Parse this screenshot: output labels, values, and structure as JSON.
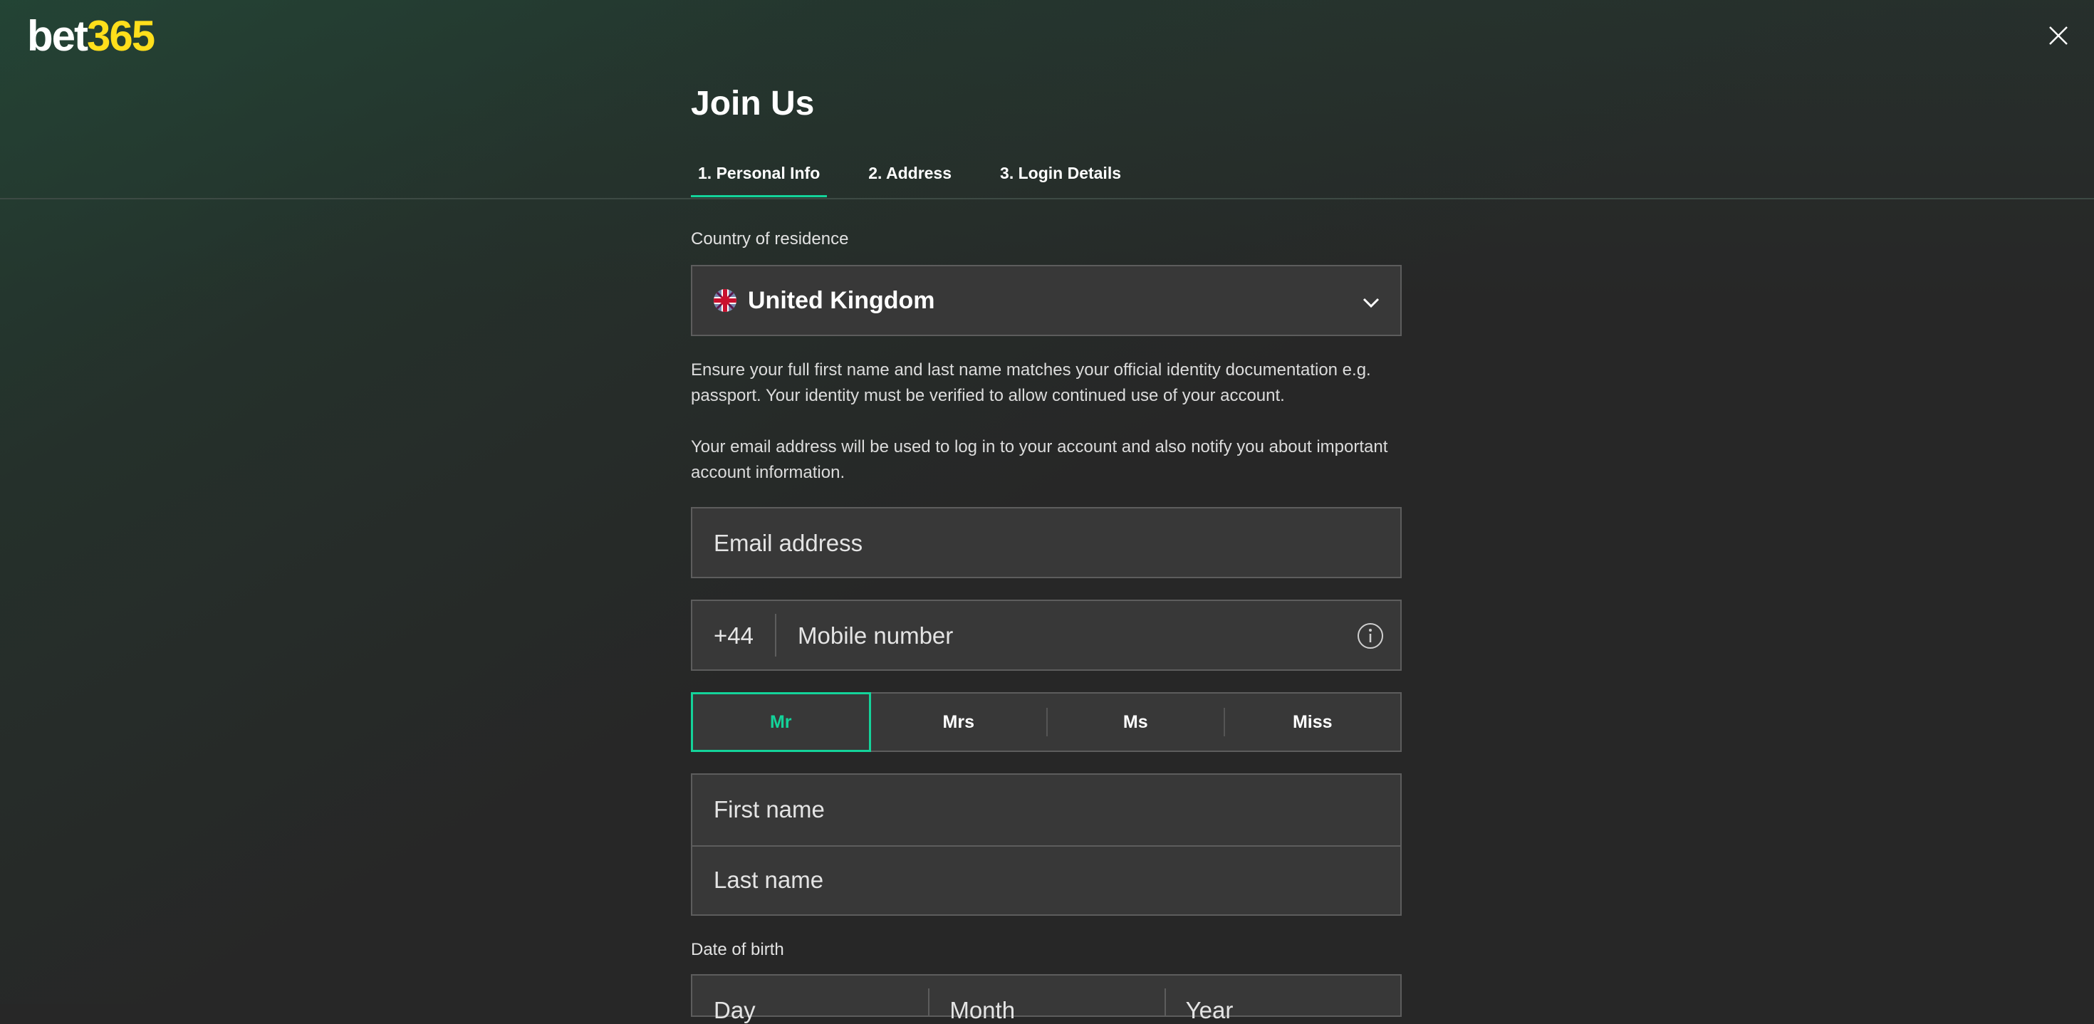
{
  "header": {
    "logo_part1": "bet",
    "logo_part2": "365",
    "close_icon": "close-icon"
  },
  "form": {
    "title": "Join Us",
    "tabs": [
      {
        "label": "1.  Personal Info",
        "active": true
      },
      {
        "label": "2.  Address",
        "active": false
      },
      {
        "label": "3.  Login Details",
        "active": false
      }
    ],
    "country_label": "Country of residence",
    "country_value": "United Kingdom",
    "flag_icon": "uk-flag-icon",
    "name_notice": "Ensure your full first name and last name matches your official identity documentation e.g. passport. Your identity must be verified to allow continued use of your account.",
    "email_notice": "Your email address will be used to log in to your account and also notify you about important account information.",
    "email_placeholder": "Email address",
    "mobile_prefix": "+44",
    "mobile_placeholder": "Mobile number",
    "titles": [
      "Mr",
      "Mrs",
      "Ms",
      "Miss"
    ],
    "selected_title": "Mr",
    "first_name_placeholder": "First name",
    "last_name_placeholder": "Last name",
    "dob_label": "Date of birth",
    "dob_day_placeholder": "Day",
    "dob_month_placeholder": "Month",
    "dob_year_placeholder": "Year"
  },
  "colors": {
    "accent": "#14d39a",
    "logo_yellow": "#ffdf1b",
    "background": "#272727",
    "field_bg": "#383838"
  }
}
